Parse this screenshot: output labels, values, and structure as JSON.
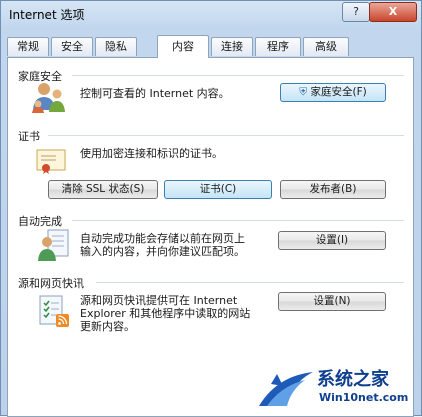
{
  "window": {
    "title": "Internet 选项",
    "help_label": "?",
    "close_label": "X"
  },
  "tabs": [
    {
      "label": "常规"
    },
    {
      "label": "安全"
    },
    {
      "label": "隐私"
    },
    {
      "label": "内容",
      "active": true
    },
    {
      "label": "连接"
    },
    {
      "label": "程序"
    },
    {
      "label": "高级"
    }
  ],
  "family_safety": {
    "heading": "家庭安全",
    "description": "控制可查看的 Internet 内容。",
    "button_label": "家庭安全(F)"
  },
  "certificates": {
    "heading": "证书",
    "description": "使用加密连接和标识的证书。",
    "clear_ssl_label": "清除 SSL 状态(S)",
    "certificates_label": "证书(C)",
    "publishers_label": "发布者(B)"
  },
  "autocomplete": {
    "heading": "自动完成",
    "description_line1": "自动完成功能会存储以前在网页上",
    "description_line2": "输入的内容，并向你建议匹配项。",
    "settings_label": "设置(I)"
  },
  "feeds": {
    "heading": "源和网页快讯",
    "description_line1": "源和网页快讯提供可在 Internet",
    "description_line2": "Explorer 和其他程序中读取的网站",
    "description_line3": "更新内容。",
    "settings_label": "设置(N)"
  },
  "watermark": {
    "title": "系统之家",
    "url": "Win10net.com"
  },
  "colors": {
    "accent": "#3c7fb1",
    "watermark": "#0f3f8f"
  }
}
